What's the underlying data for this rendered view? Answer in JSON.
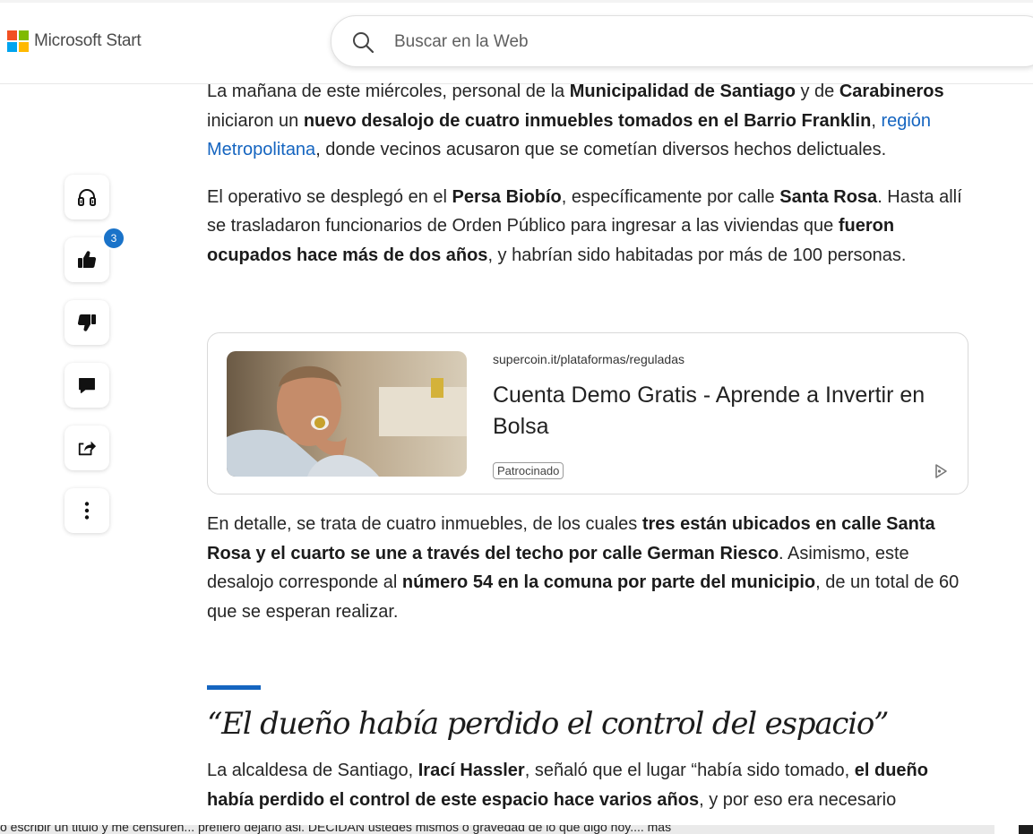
{
  "brand": {
    "name": "Microsoft Start",
    "logo_colors": [
      "#f25022",
      "#7fba00",
      "#00a4ef",
      "#ffb900"
    ]
  },
  "search": {
    "placeholder": "Buscar en la Web",
    "icon": "search-icon"
  },
  "rail": {
    "buttons": [
      {
        "name": "listen",
        "icon": "headphones-icon"
      },
      {
        "name": "like",
        "icon": "thumbs-up-icon",
        "count": "3"
      },
      {
        "name": "dislike",
        "icon": "thumbs-down-icon"
      },
      {
        "name": "comment",
        "icon": "comment-icon"
      },
      {
        "name": "share",
        "icon": "share-icon"
      },
      {
        "name": "more",
        "icon": "more-vertical-icon"
      }
    ],
    "badge_color": "#1a73c9"
  },
  "article": {
    "p1": {
      "t1": "La mañana de este miércoles, personal de la ",
      "b1": "Municipalidad de Santiago",
      "t2": " y de ",
      "b2": "Carabineros",
      "t3": " iniciaron un ",
      "b3": "nuevo desalojo de cuatro inmuebles tomados en el Barrio Franklin",
      "t4": ", ",
      "link": "región Metropolitana",
      "t5": ", donde vecinos acusaron que se cometían diversos hechos delictuales."
    },
    "p2": {
      "t1": "El operativo se desplegó en el ",
      "b1": "Persa Biobío",
      "t2": ", específicamente por calle ",
      "b2": "Santa Rosa",
      "t3": ". Hasta allí se trasladaron funcionarios de Orden Público para ingresar a las viviendas que ",
      "b3": "fueron ocupados hace más de dos años",
      "t4": ", y habrían sido habitadas por más de 100 personas."
    },
    "p3": {
      "t1": "En detalle, se trata de cuatro inmuebles, de los cuales ",
      "b1": "tres están ubicados en calle Santa Rosa y el cuarto se une a través del techo por calle German Riesco",
      "t2": ". Asimismo, este desalojo corresponde al ",
      "b2": "número 54 en la comuna por parte del municipio",
      "t3": ", de un total de 60 que se esperan realizar."
    },
    "heading": "“El dueño había perdido el control del espacio”",
    "p4": {
      "t1": "La alcaldesa de Santiago, ",
      "b1": "Irací Hassler",
      "t2": ", señaló que el lugar “había sido tomado, ",
      "b2": "el dueño había perdido el control de este espacio hace varios años",
      "t3": ", y por eso era necesario"
    },
    "accent_color": "#1565c0"
  },
  "ad": {
    "domain": "supercoin.it/plataformas/reguladas",
    "title": "Cuenta Demo Gratis - Aprende a Invertir en Bolsa",
    "badge": "Patrocinado",
    "choice_icon": "ad-choices-icon"
  },
  "tooltip": {
    "text": "o escribir un titulo y me censuren... prefiero dejarlo asi. DECIDAN ustedes mismos o gravedad de lo que digo hoy.... más"
  }
}
